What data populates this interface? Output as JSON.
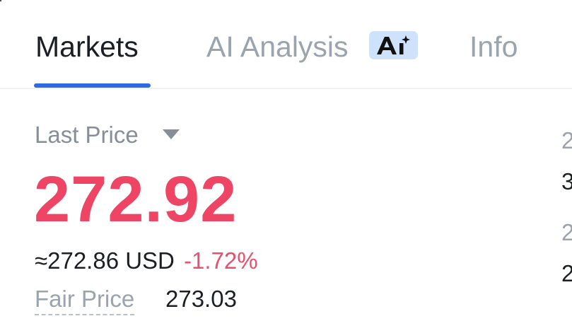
{
  "tabs": [
    {
      "label": "Markets",
      "active": true
    },
    {
      "label": "AI Analysis",
      "active": false,
      "badge_icon": "ai-sparkle-icon"
    },
    {
      "label": "Info",
      "active": false
    }
  ],
  "colors": {
    "accent": "#2f6be0",
    "price_down": "#ee4565",
    "badge_bg": "#cfe2fb"
  },
  "price": {
    "label": "Last Price",
    "dropdown_icon": "caret-down-icon",
    "value": "272.92",
    "approx": "≈272.86 USD",
    "change_pct": "-1.72%",
    "fair_label": "Fair Price",
    "fair_value": "273.03"
  },
  "right_column": {
    "row1": "2",
    "row2": "3",
    "row3": "2",
    "row4": "2"
  }
}
